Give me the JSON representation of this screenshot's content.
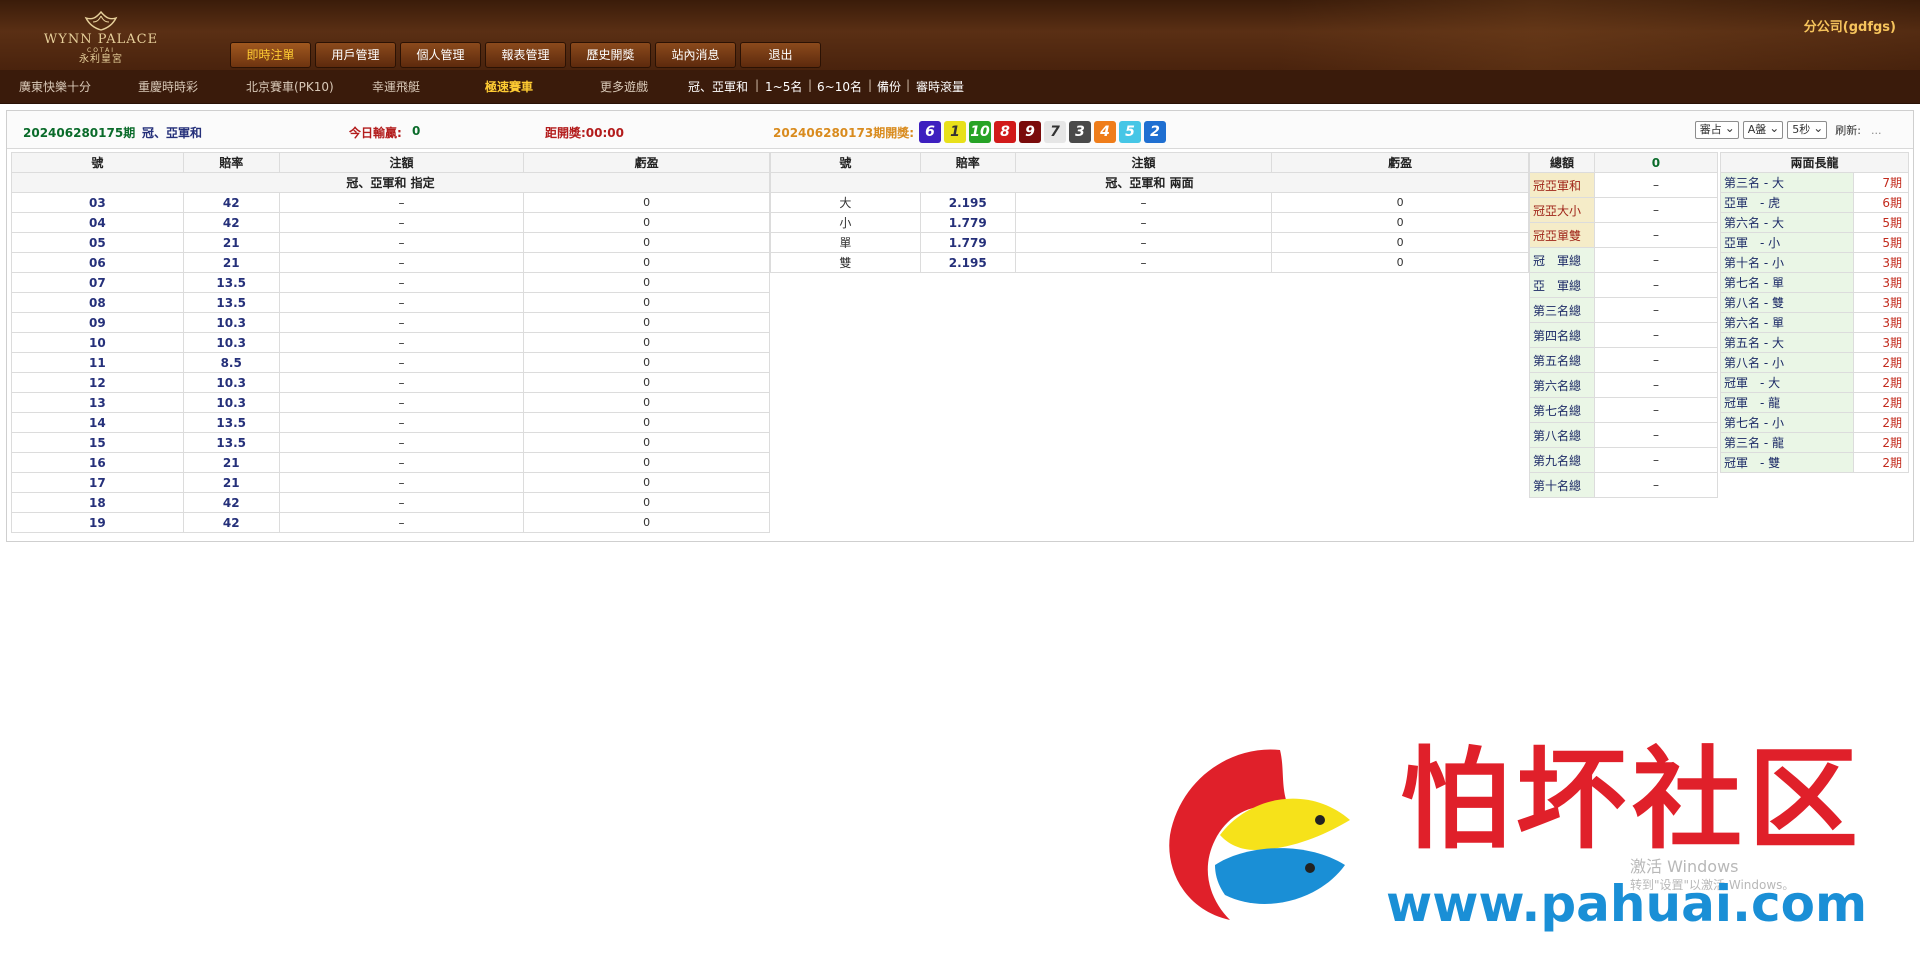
{
  "logo": {
    "brand": "WYNN PALACE",
    "sub": "COTAI",
    "cn": "永利皇宮"
  },
  "menu": [
    {
      "label": "即時注單",
      "active": true
    },
    {
      "label": "用戶管理"
    },
    {
      "label": "個人管理"
    },
    {
      "label": "報表管理"
    },
    {
      "label": "歷史開獎"
    },
    {
      "label": "站內消息"
    },
    {
      "label": "退出"
    }
  ],
  "company": "分公司(gdfgs)",
  "subnav": {
    "games": [
      "廣東快樂十分",
      "重慶時時彩",
      "北京賽車(PK10)",
      "幸運飛艇",
      "極速賽車",
      "更多遊戲"
    ],
    "links": [
      "冠、亞軍和",
      "1~5名",
      "6~10名",
      "備份",
      "審時滾量"
    ],
    "sep": "|"
  },
  "infobar": {
    "period": "202406280175期",
    "play": "冠、亞軍和",
    "today_label": "今日輸贏:",
    "today_value": "0",
    "countdown": "距開獎:00:00",
    "last_draw": "202406280173期開獎:",
    "balls": [
      {
        "n": "6",
        "color": "#3d1fbf"
      },
      {
        "n": "1",
        "color": "#e8e01a"
      },
      {
        "n": "10",
        "color": "#27a326"
      },
      {
        "n": "8",
        "color": "#d11a1a"
      },
      {
        "n": "9",
        "color": "#7a0b0b"
      },
      {
        "n": "7",
        "color": "#e6e6e6"
      },
      {
        "n": "3",
        "color": "#4a4a4a"
      },
      {
        "n": "4",
        "color": "#ef7d1a"
      },
      {
        "n": "5",
        "color": "#46c6e6"
      },
      {
        "n": "2",
        "color": "#1f6fd1"
      }
    ],
    "select1": "審占",
    "select2": "A盤",
    "select3": "5秒",
    "refresh_label": "刷新:",
    "refresh_value": "..."
  },
  "left_table": {
    "headers": [
      "號",
      "賠率",
      "注額",
      "虧盈"
    ],
    "subtitle": "冠、亞軍和 指定",
    "rows": [
      [
        "03",
        "42",
        "–",
        "0"
      ],
      [
        "04",
        "42",
        "–",
        "0"
      ],
      [
        "05",
        "21",
        "–",
        "0"
      ],
      [
        "06",
        "21",
        "–",
        "0"
      ],
      [
        "07",
        "13.5",
        "–",
        "0"
      ],
      [
        "08",
        "13.5",
        "–",
        "0"
      ],
      [
        "09",
        "10.3",
        "–",
        "0"
      ],
      [
        "10",
        "10.3",
        "–",
        "0"
      ],
      [
        "11",
        "8.5",
        "–",
        "0"
      ],
      [
        "12",
        "10.3",
        "–",
        "0"
      ],
      [
        "13",
        "10.3",
        "–",
        "0"
      ],
      [
        "14",
        "13.5",
        "–",
        "0"
      ],
      [
        "15",
        "13.5",
        "–",
        "0"
      ],
      [
        "16",
        "21",
        "–",
        "0"
      ],
      [
        "17",
        "21",
        "–",
        "0"
      ],
      [
        "18",
        "42",
        "–",
        "0"
      ],
      [
        "19",
        "42",
        "–",
        "0"
      ]
    ]
  },
  "mid_table": {
    "headers": [
      "號",
      "賠率",
      "注額",
      "虧盈"
    ],
    "subtitle": "冠、亞軍和 兩面",
    "rows": [
      [
        "大",
        "2.195",
        "–",
        "0"
      ],
      [
        "小",
        "1.779",
        "–",
        "0"
      ],
      [
        "單",
        "1.779",
        "–",
        "0"
      ],
      [
        "雙",
        "2.195",
        "–",
        "0"
      ]
    ]
  },
  "total_table": {
    "header": "總額",
    "header_value": "0",
    "rows": [
      {
        "name": "冠亞軍和",
        "value": "–",
        "red": true
      },
      {
        "name": "冠亞大小",
        "value": "–",
        "red": true
      },
      {
        "name": "冠亞單雙",
        "value": "–",
        "red": true
      },
      {
        "name": "冠　軍總",
        "value": "–"
      },
      {
        "name": "亞　軍總",
        "value": "–"
      },
      {
        "name": "第三名總",
        "value": "–"
      },
      {
        "name": "第四名總",
        "value": "–"
      },
      {
        "name": "第五名總",
        "value": "–"
      },
      {
        "name": "第六名總",
        "value": "–"
      },
      {
        "name": "第七名總",
        "value": "–"
      },
      {
        "name": "第八名總",
        "value": "–"
      },
      {
        "name": "第九名總",
        "value": "–"
      },
      {
        "name": "第十名總",
        "value": "–"
      }
    ]
  },
  "long_table": {
    "header": "兩面長龍",
    "rows": [
      [
        "第三名 - 大",
        "7期"
      ],
      [
        "亞軍　- 虎",
        "6期"
      ],
      [
        "第六名 - 大",
        "5期"
      ],
      [
        "亞軍　- 小",
        "5期"
      ],
      [
        "第十名 - 小",
        "3期"
      ],
      [
        "第七名 - 單",
        "3期"
      ],
      [
        "第八名 - 雙",
        "3期"
      ],
      [
        "第六名 - 單",
        "3期"
      ],
      [
        "第五名 - 大",
        "3期"
      ],
      [
        "第八名 - 小",
        "2期"
      ],
      [
        "冠軍　- 大",
        "2期"
      ],
      [
        "冠軍　- 龍",
        "2期"
      ],
      [
        "第七名 - 小",
        "2期"
      ],
      [
        "第三名 - 龍",
        "2期"
      ],
      [
        "冠軍　- 雙",
        "2期"
      ]
    ]
  },
  "watermark": {
    "text": "怕坏社区",
    "url": "www.pahuai.com",
    "activate": "激活 Windows",
    "activate_sub": "转到\"设置\"以激活 Windows。"
  }
}
